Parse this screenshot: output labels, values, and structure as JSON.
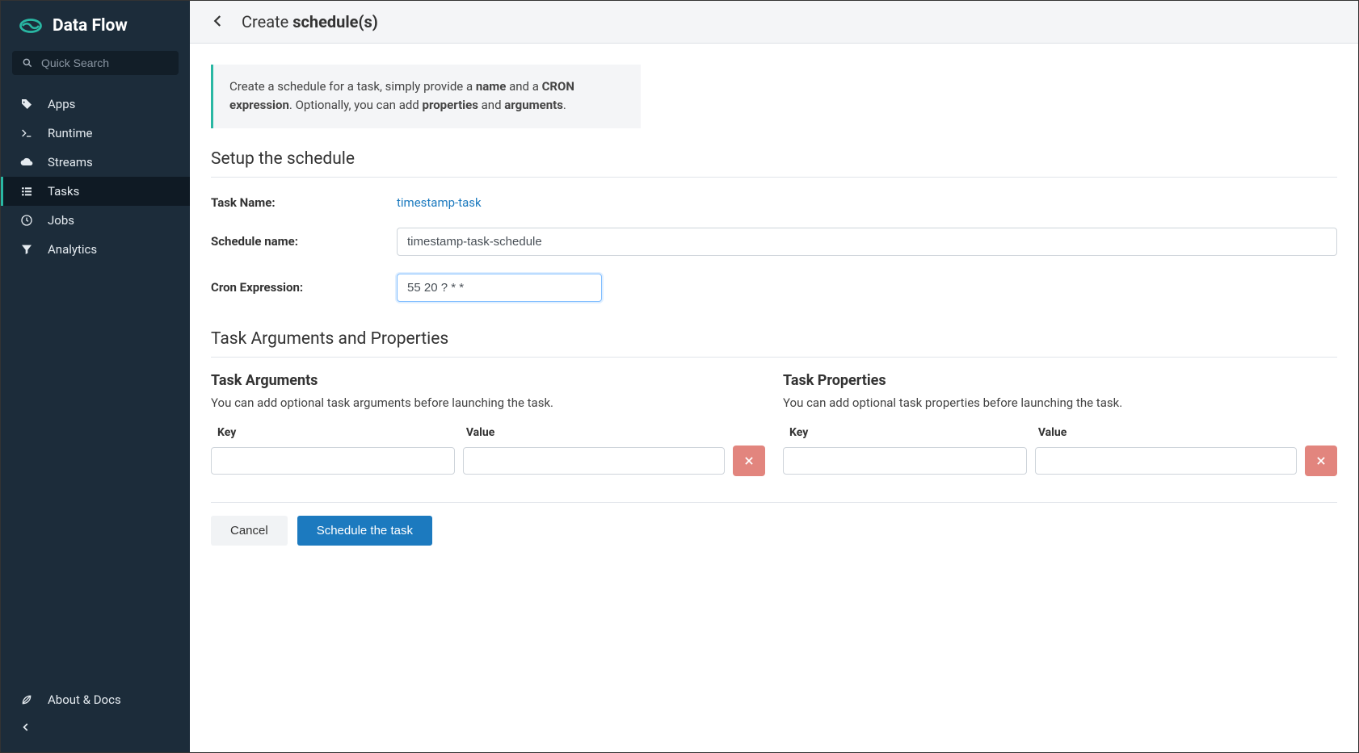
{
  "brand": {
    "name": "Data Flow"
  },
  "search": {
    "placeholder": "Quick Search"
  },
  "nav": {
    "items": [
      {
        "label": "Apps"
      },
      {
        "label": "Runtime"
      },
      {
        "label": "Streams"
      },
      {
        "label": "Tasks"
      },
      {
        "label": "Jobs"
      },
      {
        "label": "Analytics"
      }
    ]
  },
  "footer": {
    "about": "About & Docs"
  },
  "page_title": {
    "prefix": "Create ",
    "strong": "schedule(s)"
  },
  "info": {
    "line1_pre": "Create a schedule for a task, simply provide a ",
    "line1_strong1": "name",
    "line1_mid": " and a ",
    "line1_strong2": "CRON expression",
    "line1_post": ". Optionally, you can add ",
    "line1_strong3": "properties",
    "line1_and": " and ",
    "line1_strong4": "arguments",
    "line1_end": "."
  },
  "sections": {
    "setup": "Setup the schedule",
    "args_props": "Task Arguments and Properties"
  },
  "form": {
    "task_name_label": "Task Name:",
    "task_name_value": "timestamp-task",
    "schedule_name_label": "Schedule name:",
    "schedule_name_value": "timestamp-task-schedule",
    "cron_label": "Cron Expression:",
    "cron_value": "55 20 ? * *"
  },
  "task_args": {
    "heading": "Task Arguments",
    "desc": "You can add optional task arguments before launching the task.",
    "key_header": "Key",
    "value_header": "Value"
  },
  "task_props": {
    "heading": "Task Properties",
    "desc": "You can add optional task properties before launching the task.",
    "key_header": "Key",
    "value_header": "Value"
  },
  "actions": {
    "cancel": "Cancel",
    "submit": "Schedule the task"
  }
}
